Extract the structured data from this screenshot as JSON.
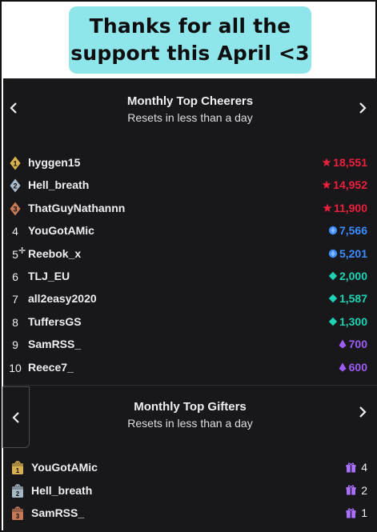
{
  "banner": {
    "line1": "Thanks for all the",
    "line2": "support this April <3"
  },
  "cheerers": {
    "title": "Monthly Top Cheerers",
    "subtitle": "Resets in less than a day",
    "rows": [
      {
        "rank": "1",
        "name": "hyggen15",
        "amount": "18,551",
        "tier": "red"
      },
      {
        "rank": "2",
        "name": "Hell_breath",
        "amount": "14,952",
        "tier": "red"
      },
      {
        "rank": "3",
        "name": "ThatGuyNathannn",
        "amount": "11,900",
        "tier": "red"
      },
      {
        "rank": "4",
        "name": "YouGotAMic",
        "amount": "7,566",
        "tier": "blue"
      },
      {
        "rank": "5",
        "name": "Reebok_x",
        "amount": "5,201",
        "tier": "blue"
      },
      {
        "rank": "6",
        "name": "TLJ_EU",
        "amount": "2,000",
        "tier": "teal"
      },
      {
        "rank": "7",
        "name": "all2easy2020",
        "amount": "1,587",
        "tier": "teal"
      },
      {
        "rank": "8",
        "name": "TuffersGS",
        "amount": "1,300",
        "tier": "teal"
      },
      {
        "rank": "9",
        "name": "SamRSS_",
        "amount": "700",
        "tier": "purple"
      },
      {
        "rank": "10",
        "name": "Reece7_",
        "amount": "600",
        "tier": "purple"
      }
    ]
  },
  "gifters": {
    "title": "Monthly Top Gifters",
    "subtitle": "Resets in less than a day",
    "rows": [
      {
        "rank": "1",
        "name": "YouGotAMic",
        "count": "4"
      },
      {
        "rank": "2",
        "name": "Hell_breath",
        "count": "2"
      },
      {
        "rank": "3",
        "name": "SamRSS_",
        "count": "1"
      }
    ]
  },
  "colors": {
    "red": "#ec1f3c",
    "blue": "#3d8cff",
    "teal": "#1ed2b4",
    "purple": "#9c5cf5",
    "gold": "#d9b050",
    "silver": "#a7b8c6",
    "bronze": "#c77a58",
    "gift": "#a970ff"
  },
  "icons": {
    "prev": "chevron-left-icon",
    "next": "chevron-right-icon",
    "badge": "rank-badge-icon",
    "bits": "bits-icon",
    "gift": "gift-icon",
    "gift_badge": "gift-badge-icon"
  }
}
